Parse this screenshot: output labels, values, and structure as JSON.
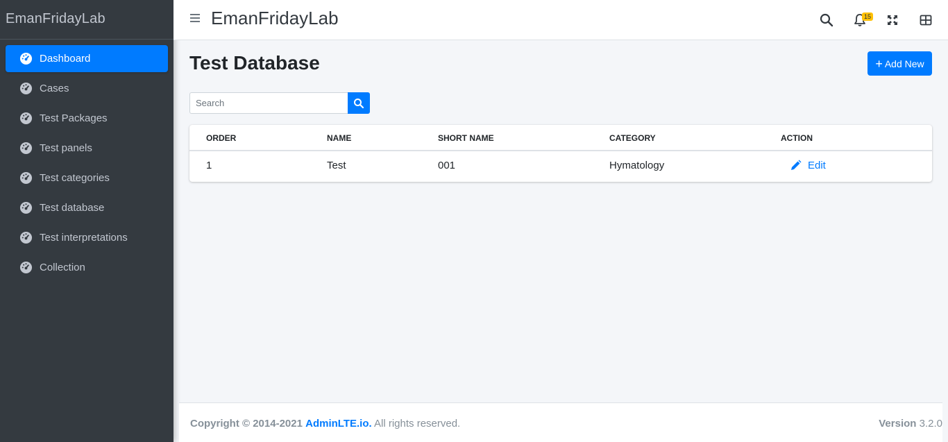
{
  "brand": "EmanFridayLab",
  "sidebar": {
    "items": [
      {
        "label": "Dashboard",
        "icon": "dashboard-gauge-icon",
        "active": true
      },
      {
        "label": "Cases",
        "icon": "dashboard-gauge-icon"
      },
      {
        "label": "Test Packages",
        "icon": "dashboard-gauge-icon"
      },
      {
        "label": "Test panels",
        "icon": "dashboard-gauge-icon"
      },
      {
        "label": "Test categories",
        "icon": "dashboard-gauge-icon"
      },
      {
        "label": "Test database",
        "icon": "dashboard-gauge-icon"
      },
      {
        "label": "Test interpretations",
        "icon": "dashboard-gauge-icon"
      },
      {
        "label": "Collection",
        "icon": "dashboard-gauge-icon"
      }
    ]
  },
  "header": {
    "title": "EmanFridayLab",
    "notifications_count": "15",
    "icons": [
      "menu-icon",
      "search-icon",
      "bell-icon",
      "fullscreen-icon",
      "grid-icon"
    ]
  },
  "main": {
    "page_title": "Test Database",
    "add_button_label": "Add New",
    "search": {
      "placeholder": "Search",
      "value": ""
    },
    "table": {
      "columns": [
        "ORDER",
        "NAME",
        "SHORT NAME",
        "CATEGORY",
        "ACTION"
      ],
      "rows": [
        {
          "order": "1",
          "name": "Test",
          "short_name": "001",
          "category": "Hymatology",
          "action": "Edit"
        }
      ]
    }
  },
  "footer": {
    "copyright_prefix": "Copyright © 2014-2021",
    "link_text": "AdminLTE.io.",
    "suffix": "All rights reserved.",
    "version_label": "Version",
    "version_value": "3.2.0"
  },
  "colors": {
    "accent": "#007bff",
    "sidebar": "#343a40",
    "badge": "#ffc107"
  }
}
